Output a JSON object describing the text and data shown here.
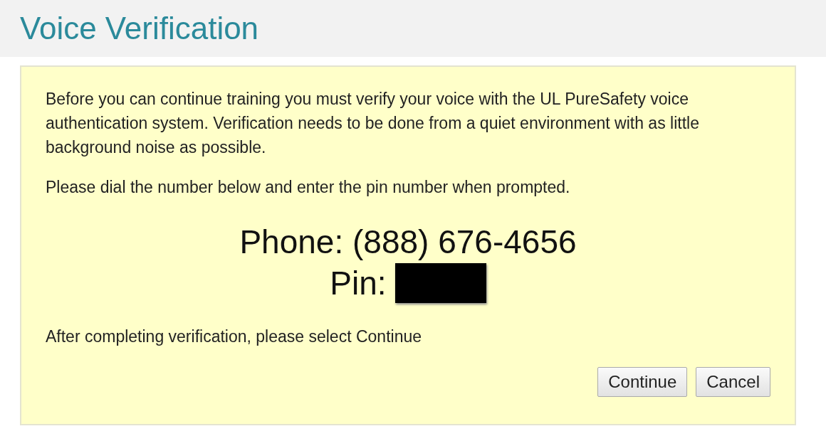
{
  "page_title": "Voice Verification",
  "intro": "Before you can continue training you must verify your voice with the UL PureSafety voice authentication system. Verification needs to be done from a quiet environment with as little background noise as possible.",
  "instruction": "Please dial the number below and enter the pin number when prompted.",
  "phone": "Phone: (888) 676-4656",
  "pin_label": "Pin:",
  "after": "After completing verification, please select Continue",
  "buttons": [
    "Continue",
    "Cancel"
  ]
}
